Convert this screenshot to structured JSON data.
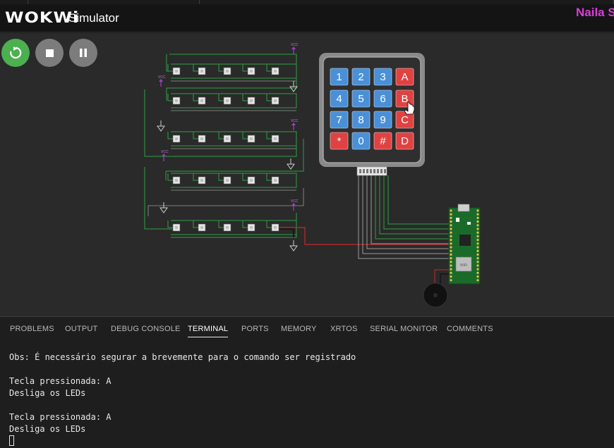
{
  "header": {
    "logo": "WOKWi",
    "title": "Simulator",
    "user": "Naila S"
  },
  "controls": {
    "restart_icon": "restart-icon",
    "stop_icon": "stop-icon",
    "pause_icon": "pause-icon",
    "restart_color": "#4caf50",
    "stop_color": "#7c7c7c"
  },
  "circuit": {
    "vcc_labels": [
      "VCC",
      "VCC",
      "VCC",
      "VCC",
      "VCC"
    ],
    "keypad_keys": [
      [
        "1",
        "2",
        "3",
        "A"
      ],
      [
        "4",
        "5",
        "6",
        "B"
      ],
      [
        "7",
        "8",
        "9",
        "C"
      ],
      [
        "*",
        "0",
        "#",
        "D"
      ]
    ],
    "board_chip_label": "WiFi",
    "key_blue": "#4a90d9",
    "key_red": "#e04242",
    "wire_green": "#2ea043",
    "wire_red": "#c62828"
  },
  "panel": {
    "tabs": [
      "PROBLEMS",
      "OUTPUT",
      "DEBUG CONSOLE",
      "TERMINAL",
      "PORTS",
      "MEMORY",
      "XRTOS",
      "SERIAL MONITOR",
      "COMMENTS"
    ],
    "active_tab": "TERMINAL",
    "terminal_lines": [
      "Obs: É necessário segurar a brevemente para o comando ser registrado",
      "",
      "Tecla pressionada: A",
      "Desliga os LEDs",
      "",
      "Tecla pressionada: A",
      "Desliga os LEDs"
    ]
  }
}
